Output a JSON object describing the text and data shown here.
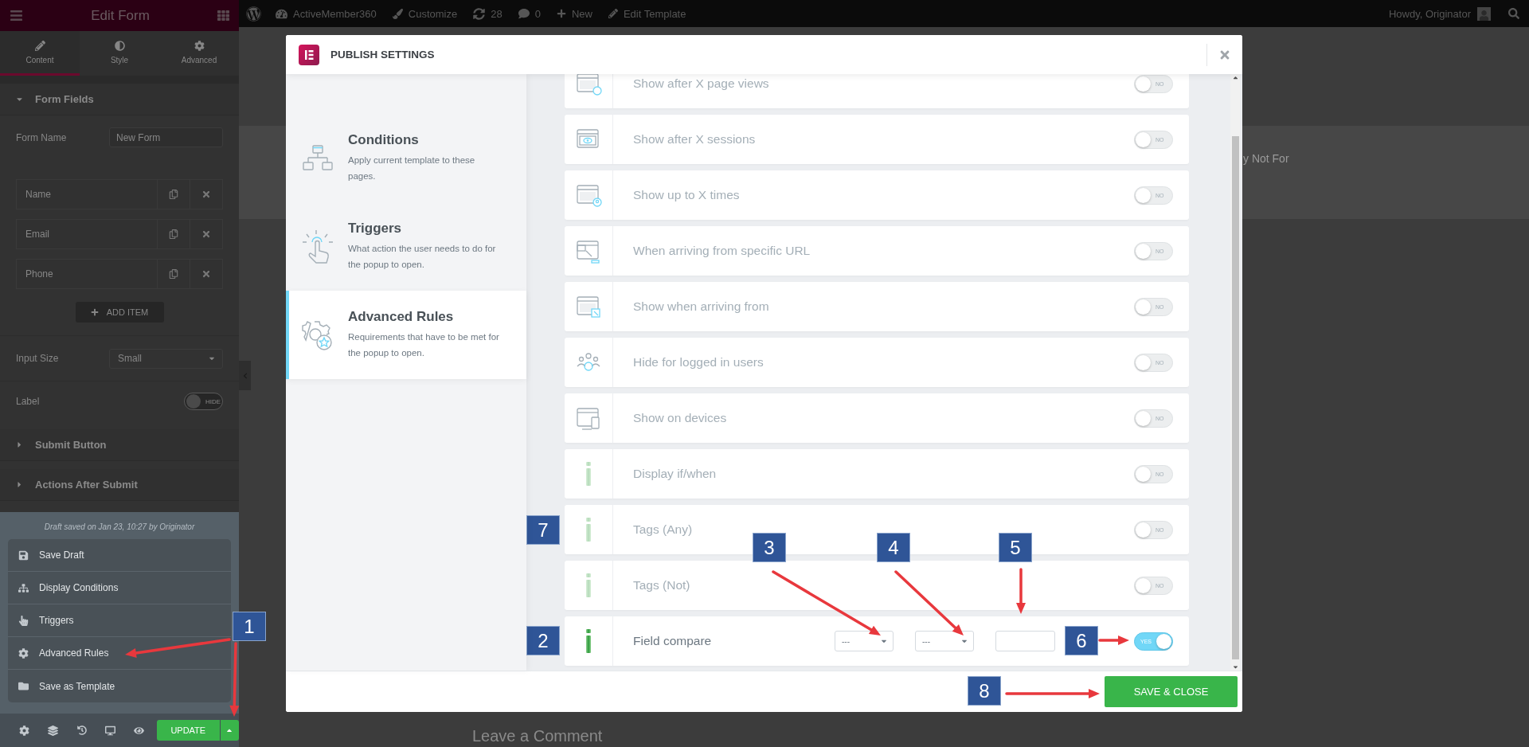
{
  "admin_bar": {
    "site": "ActiveMember360",
    "customize": "Customize",
    "updates": "28",
    "comments": "0",
    "new": "New",
    "edit": "Edit Template",
    "greeting": "Howdy, Originator"
  },
  "editor_panel": {
    "title": "Edit Form",
    "tabs": [
      {
        "label": "Content",
        "selected": true
      },
      {
        "label": "Style",
        "selected": false
      },
      {
        "label": "Advanced",
        "selected": false
      }
    ],
    "sections": [
      {
        "title": "Form Fields",
        "expanded": true
      },
      {
        "title": "Submit Button",
        "expanded": false
      },
      {
        "title": "Actions After Submit",
        "expanded": false
      }
    ],
    "form_name": {
      "label": "Form Name",
      "value": "New Form"
    },
    "fields": [
      "Name",
      "Email",
      "Phone"
    ],
    "add_item": "ADD ITEM",
    "input_size": {
      "label": "Input Size",
      "value": "Small"
    },
    "label_switch": {
      "label": "Label",
      "on": false,
      "text": "HIDE"
    }
  },
  "save_menu": {
    "status": "Draft saved on Jan 23, 10:27 by Originator",
    "items": [
      "Save Draft",
      "Display Conditions",
      "Triggers",
      "Advanced Rules",
      "Save as Template"
    ],
    "update": "UPDATE"
  },
  "page": {
    "band_text": "y Not For",
    "heading": "Leave a Comment"
  },
  "modal": {
    "title": "PUBLISH SETTINGS",
    "nav": [
      {
        "title": "Conditions",
        "description": "Apply current template to these pages.",
        "selected": false
      },
      {
        "title": "Triggers",
        "description": "What action the user needs to do for the popup to open.",
        "selected": false
      },
      {
        "title": "Advanced Rules",
        "description": "Requirements that have to be met for the popup to open.",
        "selected": true
      }
    ],
    "rules": [
      {
        "kind": "toggle",
        "label": "Show after X page views",
        "on": false,
        "toggle_text": "NO"
      },
      {
        "kind": "toggle",
        "label": "Show after X sessions",
        "on": false,
        "toggle_text": "NO"
      },
      {
        "kind": "toggle",
        "label": "Show up to X times",
        "on": false,
        "toggle_text": "NO"
      },
      {
        "kind": "toggle",
        "label": "When arriving from specific URL",
        "on": false,
        "toggle_text": "NO"
      },
      {
        "kind": "toggle",
        "label": "Show when arriving from",
        "on": false,
        "toggle_text": "NO"
      },
      {
        "kind": "toggle",
        "label": "Hide for logged in users",
        "on": false,
        "toggle_text": "NO"
      },
      {
        "kind": "toggle",
        "label": "Show on devices",
        "on": false,
        "toggle_text": "NO"
      },
      {
        "kind": "toggle",
        "label": "Display if/when",
        "on": false,
        "toggle_text": "NO"
      },
      {
        "kind": "toggle",
        "label": "Tags (Any)",
        "on": false,
        "toggle_text": "NO"
      },
      {
        "kind": "toggle",
        "label": "Tags (Not)",
        "on": false,
        "toggle_text": "NO"
      },
      {
        "kind": "compare",
        "label": "Field compare",
        "on": true,
        "toggle_text": "YES",
        "field": "---",
        "operator": "---"
      }
    ],
    "save": "SAVE & CLOSE"
  },
  "annotations": [
    {
      "label": "1"
    },
    {
      "label": "2"
    },
    {
      "label": "3"
    },
    {
      "label": "4"
    },
    {
      "label": "5"
    },
    {
      "label": "6"
    },
    {
      "label": "7"
    },
    {
      "label": "8"
    }
  ]
}
